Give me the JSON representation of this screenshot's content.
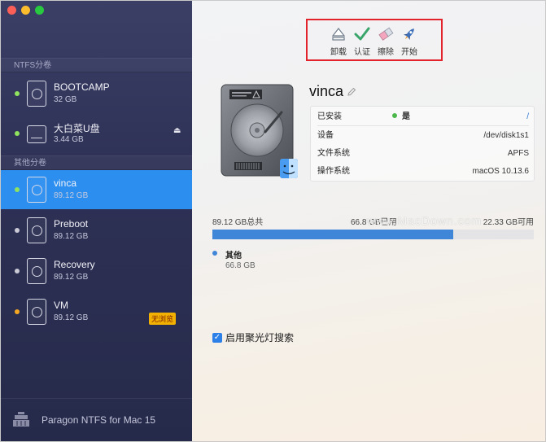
{
  "sidebar": {
    "sections": [
      {
        "title": "NTFS分卷"
      },
      {
        "title": "其他分卷"
      }
    ],
    "volumes": [
      {
        "name": "BOOTCAMP",
        "size": "32 GB",
        "status_color": "#8fe35f"
      },
      {
        "name": "大白菜U盘",
        "size": "3.44 GB",
        "status_color": "#8fe35f",
        "eject": "⏏"
      },
      {
        "name": "vinca",
        "size": "89.12 GB",
        "status_color": "#8fe35f"
      },
      {
        "name": "Preboot",
        "size": "89.12 GB",
        "status_color": "#c9cad6"
      },
      {
        "name": "Recovery",
        "size": "89.12 GB",
        "status_color": "#c9cad6"
      },
      {
        "name": "VM",
        "size": "89.12 GB",
        "status_color": "#f5a623",
        "badge": "无浏览"
      }
    ],
    "footer_label": "Paragon NTFS for Mac 15"
  },
  "toolbar": {
    "unmount_label": "卸载",
    "verify_label": "认证",
    "erase_label": "擦除",
    "start_label": "开始"
  },
  "volume": {
    "name": "vinca",
    "mounted_label": "已安装",
    "mounted_value": "是",
    "mounted_link": "/",
    "device_label": "设备",
    "device_value": "/dev/disk1s1",
    "fs_label": "文件系统",
    "fs_value": "APFS",
    "os_label": "操作系统",
    "os_value": "macOS 10.13.6"
  },
  "usage": {
    "total": "89.12 GB总共",
    "used": "66.8 GB已用",
    "free": "22.33 GB可用",
    "used_fraction": 0.7495,
    "legend_name": "其他",
    "legend_size": "66.8 GB"
  },
  "spotlight_label": "启用聚光灯搜索",
  "watermark": "www.MacDown.com",
  "colors": {
    "selected_row": "#2c8ff0",
    "toolbar_highlight": "#e3232b",
    "bar_fill": "#3f86d8"
  }
}
